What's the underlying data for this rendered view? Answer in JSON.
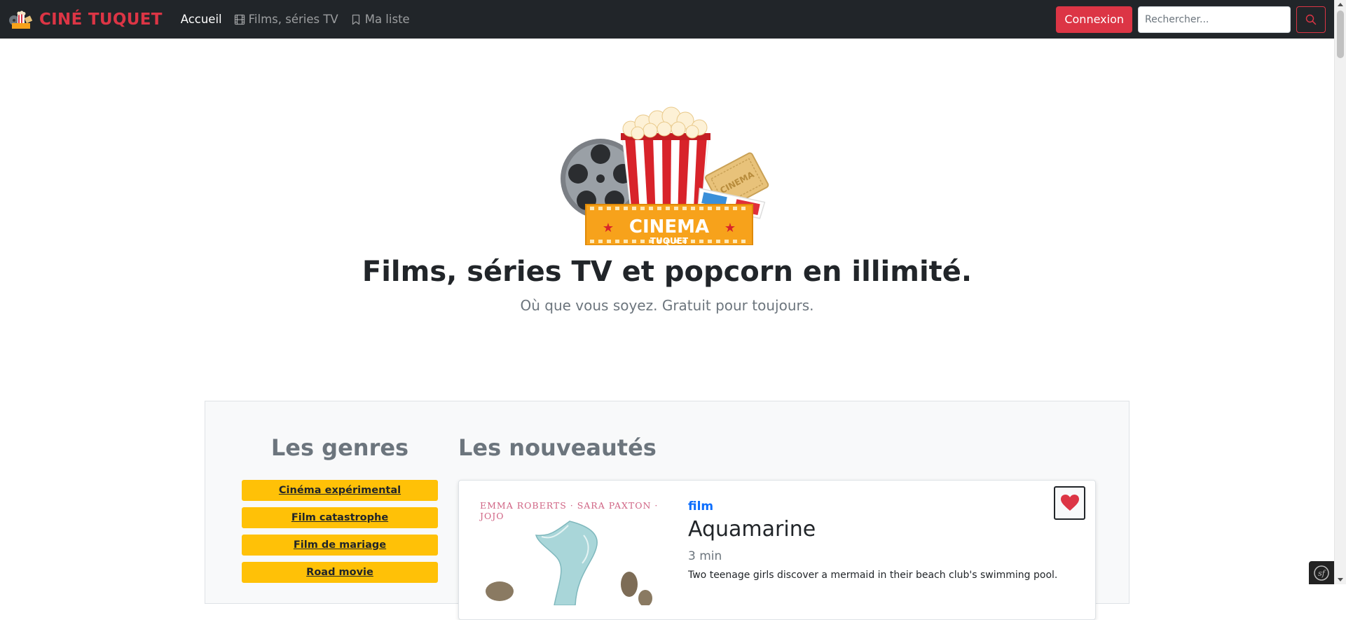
{
  "nav": {
    "brand": "CINÉ TUQUET",
    "links": [
      {
        "label": "Accueil",
        "icon": "none",
        "active": true
      },
      {
        "label": "Films, séries TV",
        "icon": "film-icon",
        "active": false
      },
      {
        "label": "Ma liste",
        "icon": "bookmark-icon",
        "active": false
      }
    ],
    "login_label": "Connexion",
    "search_placeholder": "Rechercher...",
    "search_icon": "search-icon"
  },
  "hero": {
    "logo_text": "CINEMA",
    "logo_subtext": "TUQUET",
    "ticket_text": "CINEMA",
    "title": "Films, séries TV et popcorn en illimité.",
    "subtitle": "Où que vous soyez. Gratuit pour toujours."
  },
  "genres": {
    "title": "Les genres",
    "items": [
      "Cinéma expérimental",
      "Film catastrophe",
      "Film de mariage",
      "Road movie"
    ]
  },
  "news": {
    "title": "Les nouveautés",
    "cards": [
      {
        "poster_credits": "EMMA ROBERTS · SARA PAXTON · JOJO",
        "type": "film",
        "title": "Aquamarine",
        "duration": "3 min",
        "description": "Two teenage girls discover a mermaid in their beach club's swimming pool.",
        "favorite_icon": "heart-icon"
      }
    ]
  },
  "colors": {
    "navbar": "#212529",
    "brand_red": "#dc3545",
    "genre_yellow": "#ffc107",
    "link_blue": "#0d6efd"
  }
}
